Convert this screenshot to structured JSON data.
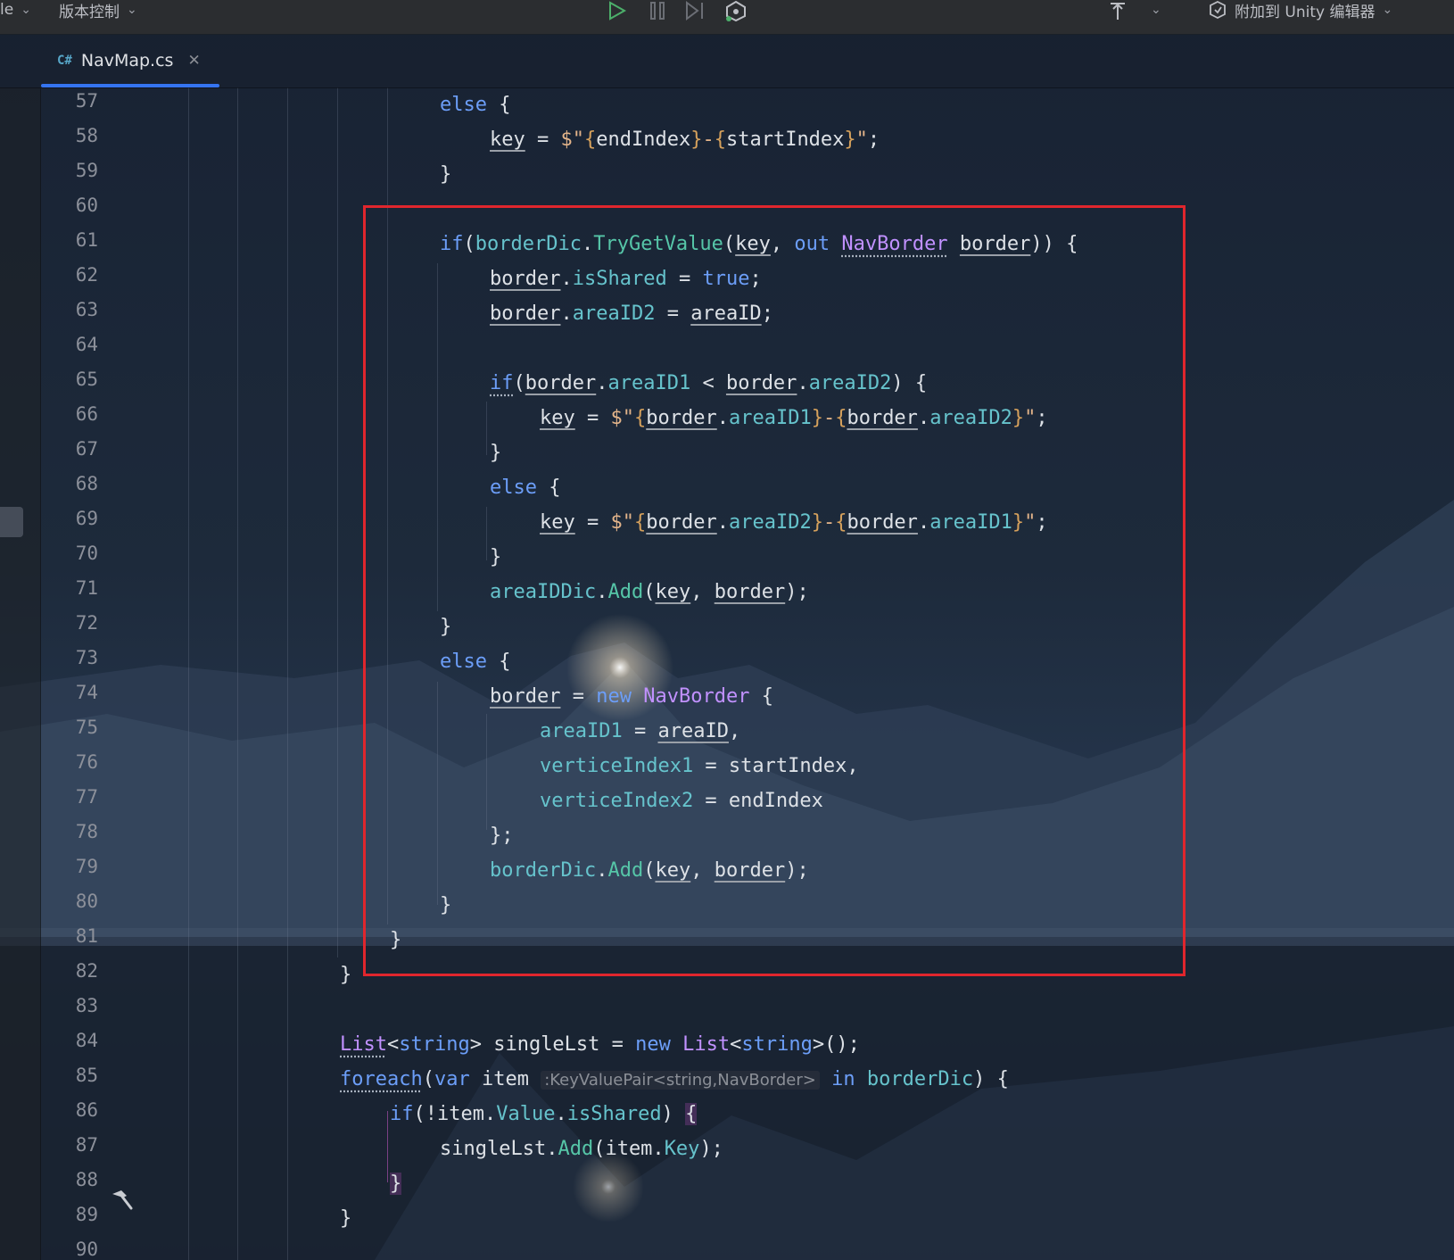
{
  "toolbar": {
    "left_partial_label": "le",
    "vcs_label": "版本控制",
    "attach_label": "附加到 Unity 编辑器"
  },
  "tab": {
    "lang_badge": "C#",
    "filename": "NavMap.cs"
  },
  "editor": {
    "line_numbers": [
      "57",
      "58",
      "59",
      "60",
      "61",
      "62",
      "63",
      "64",
      "65",
      "66",
      "67",
      "68",
      "69",
      "70",
      "71",
      "72",
      "73",
      "74",
      "75",
      "76",
      "77",
      "78",
      "79",
      "80",
      "81",
      "82",
      "83",
      "84",
      "85",
      "86",
      "87",
      "88",
      "89",
      "90"
    ],
    "inlay_hint": ":KeyValuePair<string,NavBorder>"
  },
  "colors": {
    "keyword": "#6c9ef8",
    "type": "#c191ff",
    "method": "#56c6a8",
    "property": "#66c3cc",
    "string": "#e3b48a",
    "highlight_border": "#e0262d",
    "tab_underline": "#3574f0"
  },
  "icons": [
    "chevron-down-icon",
    "run-icon",
    "pause-icon",
    "step-icon",
    "unity-debug-icon",
    "pin-icon",
    "attach-icon",
    "hammer-icon",
    "close-icon"
  ]
}
